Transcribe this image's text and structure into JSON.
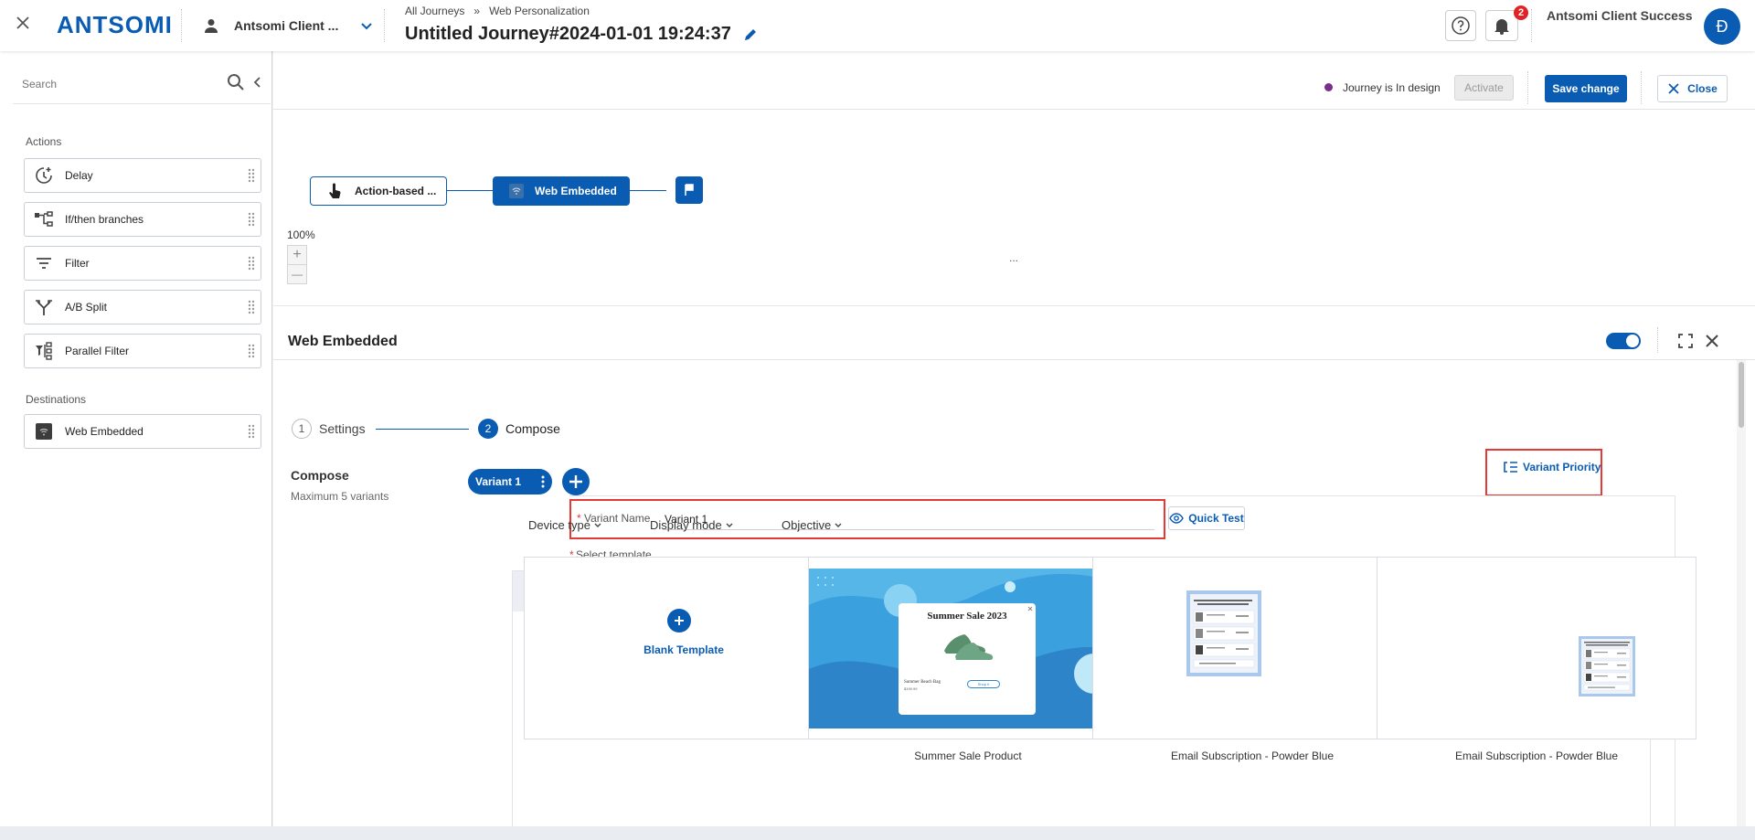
{
  "header": {
    "logo_text": "ANTSOMI",
    "account_name": "Antsomi Client ...",
    "breadcrumb": [
      "All Journeys",
      "»",
      "Web Personalization"
    ],
    "journey_title": "Untitled Journey#2024-01-01 19:24:37",
    "notification_count": "2",
    "user_name": "Antsomi Client Success",
    "avatar_initial": "Đ"
  },
  "sidebar": {
    "search_placeholder": "Search",
    "actions_title": "Actions",
    "actions": [
      {
        "label": "Delay",
        "icon": "delay-icon"
      },
      {
        "label": "If/then branches",
        "icon": "branch-icon"
      },
      {
        "label": "Filter",
        "icon": "filter-icon"
      },
      {
        "label": "A/B Split",
        "icon": "split-icon"
      },
      {
        "label": "Parallel Filter",
        "icon": "parallel-filter-icon"
      }
    ],
    "destinations_title": "Destinations",
    "destinations": [
      {
        "label": "Web Embedded",
        "icon": "web-embedded-icon"
      }
    ]
  },
  "journey_bar": {
    "status_text": "Journey is In design",
    "status_color": "#7b2d8e",
    "activate_label": "Activate",
    "save_label": "Save change",
    "close_label": "Close"
  },
  "canvas": {
    "trigger_node": "Action-based ...",
    "embedded_node": "Web Embedded",
    "zoom_level": "100%",
    "zoom_in": "+",
    "zoom_out": "—",
    "drag_handle": "..."
  },
  "panel": {
    "title": "Web Embedded",
    "steps": [
      {
        "number": "1",
        "label": "Settings"
      },
      {
        "number": "2",
        "label": "Compose"
      }
    ],
    "compose_title": "Compose",
    "compose_subtitle": "Maximum 5 variants",
    "variant_tab": "Variant 1",
    "variant_priority": "Variant Priority",
    "variant_name_label": "Variant Name",
    "variant_name_value": "Variant 1",
    "quick_test": "Quick Test",
    "select_template_label": "Select template",
    "filters": [
      "Device type",
      "Display mode",
      "Objective"
    ],
    "templates": [
      {
        "label": "Blank Template"
      },
      {
        "label": "Summer Sale Product",
        "preview_title": "Summer Sale 2023",
        "preview_item": "Summer Beach Bag",
        "preview_price": "$199.99",
        "preview_cta": "Shop It"
      },
      {
        "label": "Email Subscription - Powder Blue"
      },
      {
        "label": "Email Subscription - Powder Blue"
      }
    ]
  },
  "colors": {
    "brand_blue": "#0a5cb3",
    "highlight_red": "#e53935",
    "badge_red": "#e02424"
  }
}
